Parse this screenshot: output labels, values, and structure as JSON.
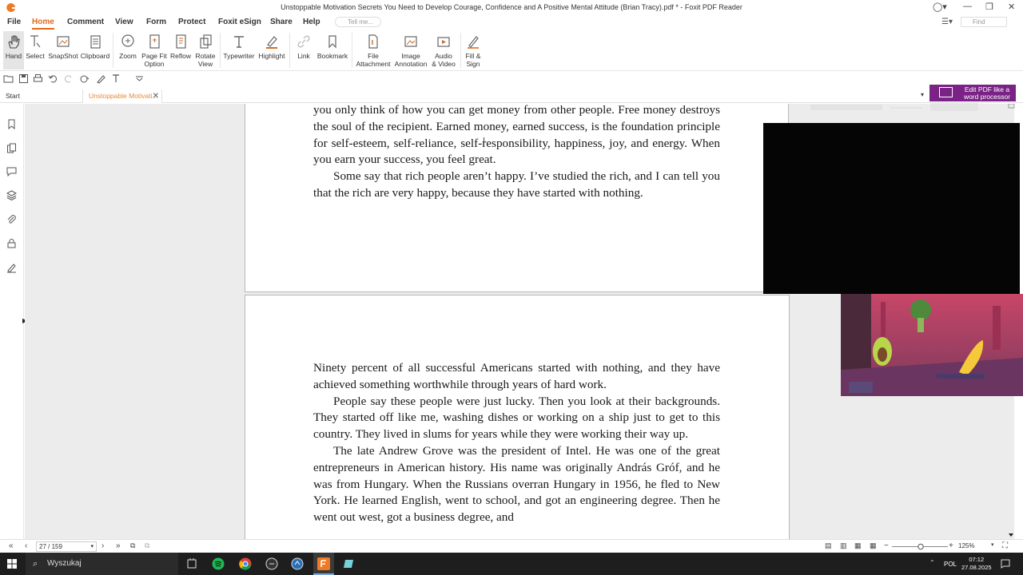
{
  "window": {
    "title": "Unstoppable Motivation Secrets You Need to Develop Courage, Confidence and A Positive Mental Attitude (Brian Tracy).pdf * - Foxit PDF Reader"
  },
  "menu": {
    "file": "File",
    "home": "Home",
    "comment": "Comment",
    "view": "View",
    "form": "Form",
    "protect": "Protect",
    "foxit_esign": "Foxit eSign",
    "share": "Share",
    "help": "Help",
    "tell_me_placeholder": "Tell me...",
    "find_placeholder": "Find"
  },
  "ribbon": {
    "hand": "Hand",
    "select": "Select",
    "snapshot": "SnapShot",
    "clipboard": "Clipboard",
    "zoom": "Zoom",
    "page_fit_1": "Page Fit",
    "page_fit_2": "Option",
    "reflow": "Reflow",
    "rotate_1": "Rotate",
    "rotate_2": "View",
    "typewriter": "Typewriter",
    "highlight": "Highlight",
    "link": "Link",
    "bookmark": "Bookmark",
    "file_attachment_1": "File",
    "file_attachment_2": "Attachment",
    "image_annotation_1": "Image",
    "image_annotation_2": "Annotation",
    "audio_video_1": "Audio",
    "audio_video_2": "& Video",
    "fill_sign_1": "Fill &",
    "fill_sign_2": "Sign"
  },
  "tabs": {
    "start": "Start",
    "document": "Unstoppable Motivati..."
  },
  "ad": {
    "line1": "Edit PDF like a",
    "line2": "word processor"
  },
  "page1": {
    "p1": "you only think of how you can get money from other people. Free money destroys the soul of the recipient. Earned money, earned success, is the foundation principle for self-esteem, self-reliance, self-responsibility, happiness, joy, and energy. When you earn your success, you feel great.",
    "p2": "Some say that rich people aren’t happy. I’ve studied the rich, and I can tell you that the rich are very happy, because they have started with nothing."
  },
  "page2": {
    "p1": "Ninety percent of all successful Americans started with nothing, and they have achieved something worthwhile through years of hard work.",
    "p2": "People say these people were just lucky. Then you look at their backgrounds. They started off like me, washing dishes or working on a ship just to get to this country. They lived in slums for years while they were working their way up.",
    "p3": "The late Andrew Grove was the president of Intel. He was one of the great entrepreneurs in American history. His name was originally András Gróf, and he was from Hungary. When the Russians overran Hungary in 1956, he fled to New York. He learned English, went to school, and got an engineering degree. Then he went out west, got a business degree, and"
  },
  "status": {
    "page_indicator": "27 / 159",
    "zoom": "125%"
  },
  "taskbar": {
    "search_placeholder": "Wyszukaj",
    "language": "POL",
    "time": "07:12",
    "date": "27.08.2025"
  },
  "colors": {
    "accent": "#e06a1b",
    "ad_purple": "#7a2286",
    "taskbar": "#1e1e1e"
  }
}
